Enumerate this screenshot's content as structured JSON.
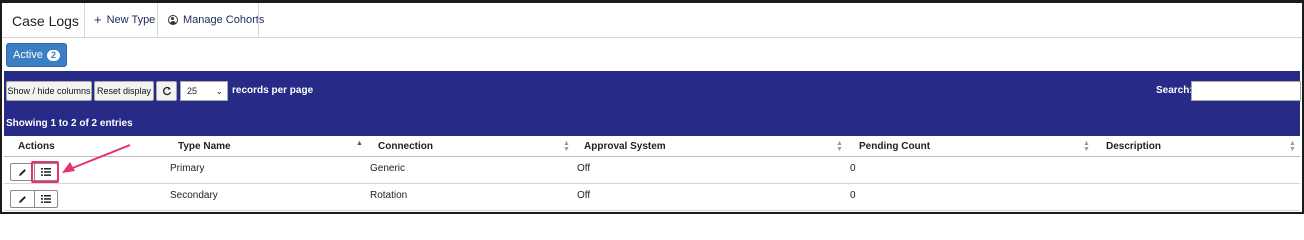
{
  "header": {
    "title": "Case Logs",
    "new_type": "New Type",
    "manage_cohorts": "Manage Cohorts"
  },
  "filter": {
    "active_label": "Active",
    "active_count": "2"
  },
  "toolbar": {
    "show_hide_columns": "Show / hide columns",
    "reset_display": "Reset display",
    "records_per_page_value": "25",
    "records_per_page_label": "records per page",
    "search_label": "Search:",
    "search_value": "",
    "showing_text": "Showing 1 to 2 of 2 entries"
  },
  "table": {
    "columns": [
      "Actions",
      "Type Name",
      "Connection",
      "Approval System",
      "Pending Count",
      "Description"
    ],
    "rows": [
      {
        "type_name": "Primary",
        "connection": "Generic",
        "approval_system": "Off",
        "pending_count": "0",
        "description": ""
      },
      {
        "type_name": "Secondary",
        "connection": "Rotation",
        "approval_system": "Off",
        "pending_count": "0",
        "description": ""
      }
    ]
  },
  "icons": {
    "new_type": "plus-icon",
    "manage_cohorts": "user-circle-icon",
    "refresh": "refresh-icon",
    "edit": "pencil-icon",
    "details": "list-icon"
  },
  "colors": {
    "toolbar_bg": "#272a86",
    "active_button": "#3a7fc3",
    "highlight": "#e8326a"
  }
}
